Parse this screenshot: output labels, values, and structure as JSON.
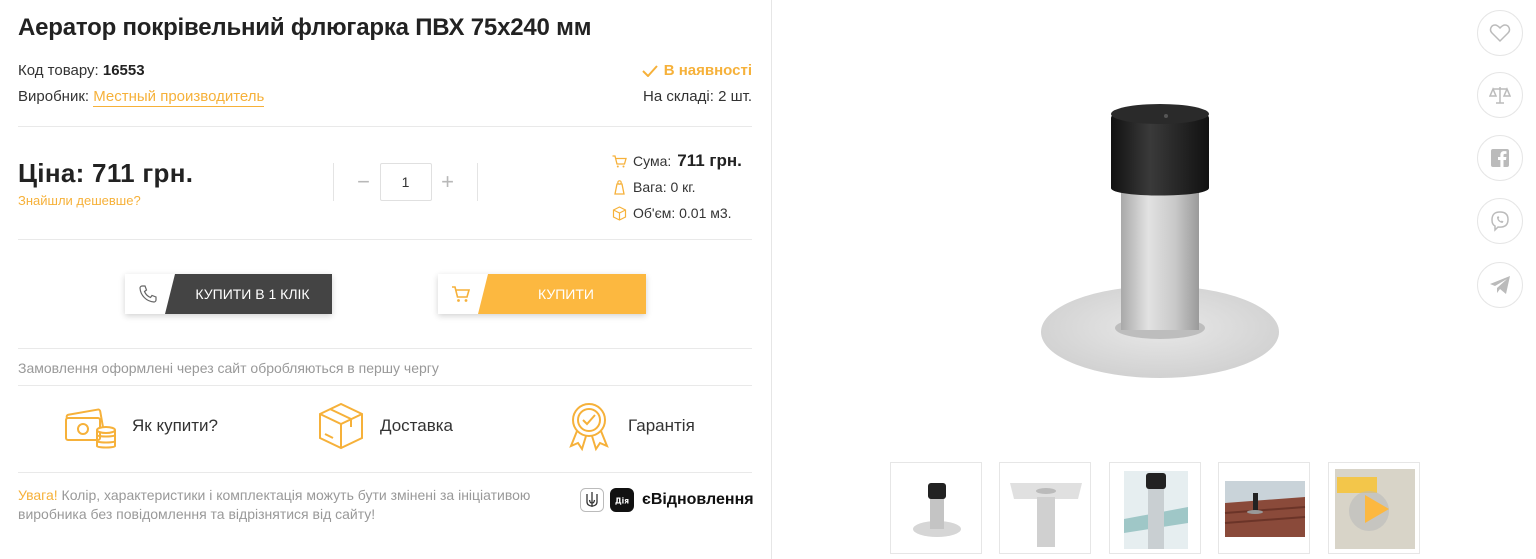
{
  "product": {
    "title": "Аератор покрівельний флюгарка ПВХ 75х240 мм",
    "code_label": "Код товару:",
    "code_value": "16553",
    "manufacturer_label": "Виробник:",
    "manufacturer_value": "Местный производитель",
    "availability": "В наявності",
    "stock": "На складі: 2 шт."
  },
  "price": {
    "label": "Ціна: 711 грн.",
    "cheaper_link": "Знайшли дешевше?",
    "quantity": "1",
    "minus": "−",
    "plus": "+",
    "sum_label": "Сума:",
    "sum_value": "711 грн.",
    "weight": "Вага: 0 кг.",
    "volume": "Об'єм: 0.01 м3."
  },
  "actions": {
    "buy_one_click": "КУПИТИ В 1 КЛІК",
    "buy": "КУПИТИ"
  },
  "info": {
    "note": "Замовлення оформлені через сайт обробляються в першу чергу",
    "features": [
      {
        "label": "Як купити?",
        "icon": "money-icon"
      },
      {
        "label": "Доставка",
        "icon": "box-icon"
      },
      {
        "label": "Гарантія",
        "icon": "medal-icon"
      }
    ],
    "warning_lead": "Увага!",
    "warning_text": " Колір, характеристики і комплектація можуть бути змінені за ініціативою виробника без повідомлення та відрізнятися від сайту!",
    "diya_logo": "Дія",
    "diya_text": "єВідновлення"
  },
  "colors": {
    "accent": "#fcb840",
    "dark_button": "#444444"
  },
  "side_icons": [
    "heart-icon",
    "scales-icon",
    "facebook-icon",
    "viber-icon",
    "telegram-icon"
  ]
}
